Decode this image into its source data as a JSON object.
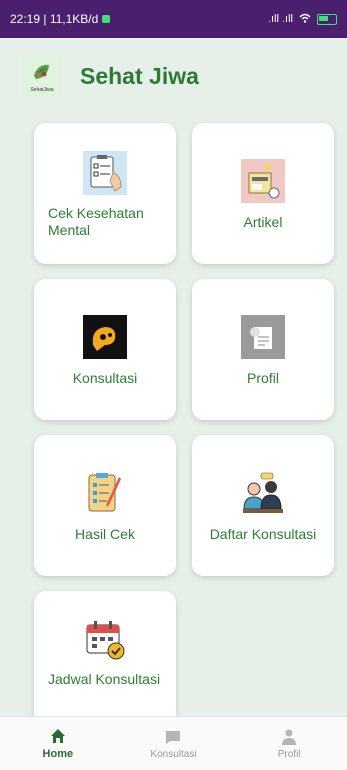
{
  "status_bar": {
    "time_net": "22:19 | 11,1KB/d",
    "signal": ".ıll .ıll",
    "wifi_icon": "wifi-icon",
    "battery_icon": "battery-icon"
  },
  "header": {
    "logo_text": "SehatJiwa",
    "title": "Sehat Jiwa"
  },
  "menu": [
    {
      "label": "Cek Kesehatan Mental",
      "icon": "checklist-clipboard-icon"
    },
    {
      "label": "Artikel",
      "icon": "article-icon"
    },
    {
      "label": "Konsultasi",
      "icon": "consultation-logo-icon"
    },
    {
      "label": "Profil",
      "icon": "profile-document-icon"
    },
    {
      "label": "Hasil Cek",
      "icon": "result-clipboard-icon"
    },
    {
      "label": "Daftar Konsultasi",
      "icon": "doctor-patient-icon"
    },
    {
      "label": "Jadwal Konsultasi",
      "icon": "calendar-check-icon"
    }
  ],
  "bottom_nav": [
    {
      "label": "Home",
      "icon": "home-icon",
      "active": true
    },
    {
      "label": "Konsultasi",
      "icon": "chat-icon",
      "active": false
    },
    {
      "label": "Profil",
      "icon": "person-icon",
      "active": false
    }
  ],
  "colors": {
    "accent": "#2c7a34",
    "background": "#e6efe8",
    "status_bar": "#4a1f6d"
  }
}
